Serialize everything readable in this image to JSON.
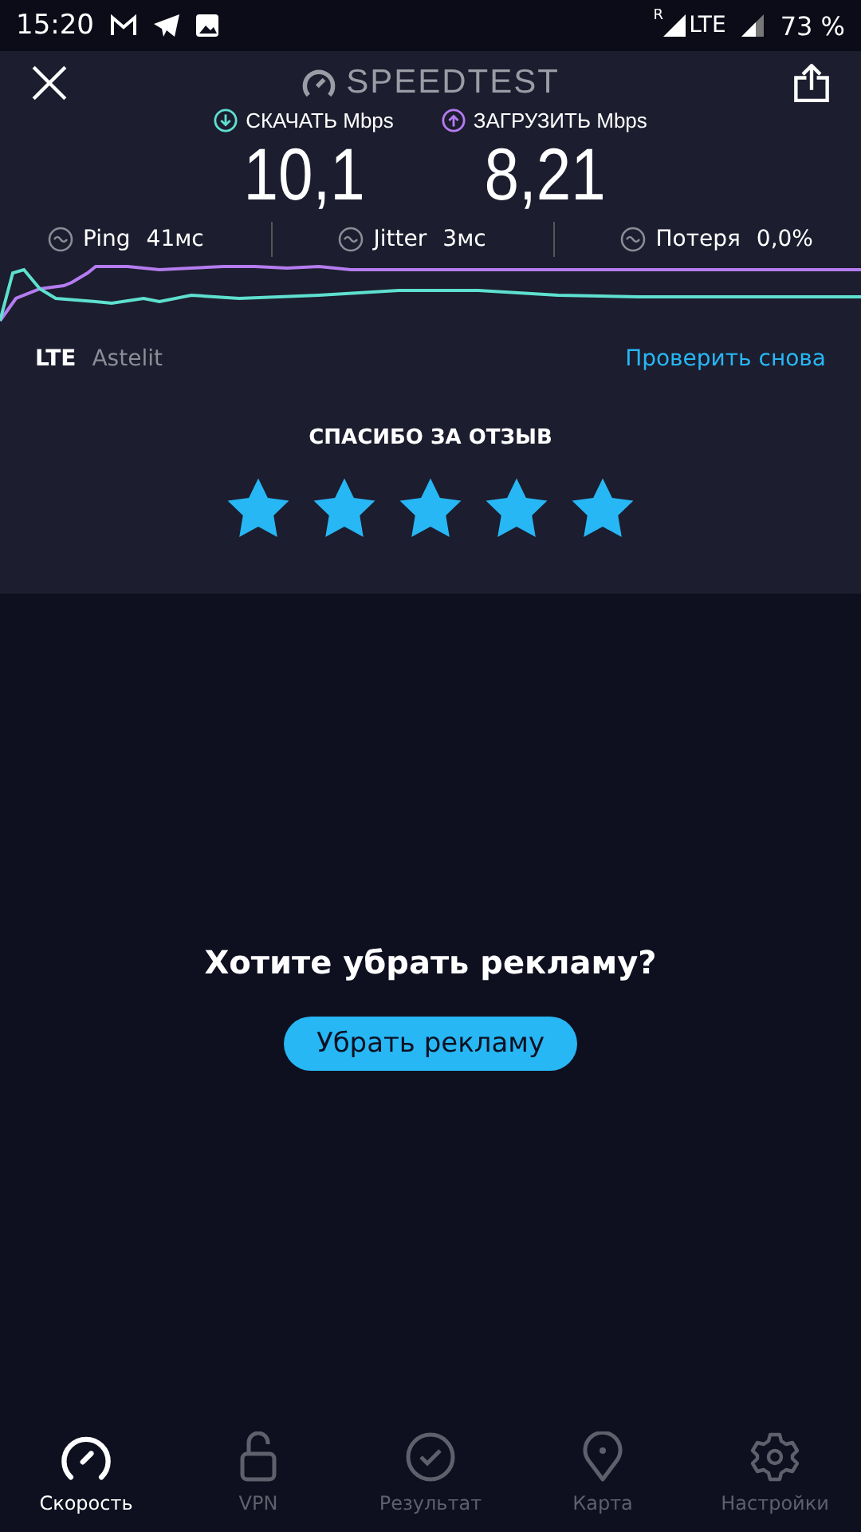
{
  "status_bar": {
    "time": "15:20",
    "roaming": "R",
    "network": "LTE",
    "battery": "73 %"
  },
  "header": {
    "title": "SPEEDTEST"
  },
  "results": [
    {
      "label": "СКАЧАТЬ",
      "unit": "Mbps",
      "value": "10,1",
      "color": "#5ee0d0"
    },
    {
      "label": "ЗАГРУЗИТЬ",
      "unit": "Mbps",
      "value": "8,21",
      "color": "#b57cf0"
    }
  ],
  "metrics": [
    {
      "label": "Ping",
      "value": "41мс"
    },
    {
      "label": "Jitter",
      "value": "3мс"
    },
    {
      "label": "Потеря",
      "value": "0,0%"
    }
  ],
  "connection": {
    "type": "LTE",
    "provider": "Astelit",
    "retest": "Проверить снова"
  },
  "feedback": {
    "title": "СПАСИБО ЗА ОТЗЫВ",
    "stars": 5
  },
  "ad": {
    "question": "Хотите убрать рекламу?",
    "button": "Убрать рекламу"
  },
  "tabs": [
    {
      "label": "Скорость",
      "selected": true
    },
    {
      "label": "VPN",
      "selected": false
    },
    {
      "label": "Результат",
      "selected": false
    },
    {
      "label": "Карта",
      "selected": false
    },
    {
      "label": "Настройки",
      "selected": false
    }
  ]
}
